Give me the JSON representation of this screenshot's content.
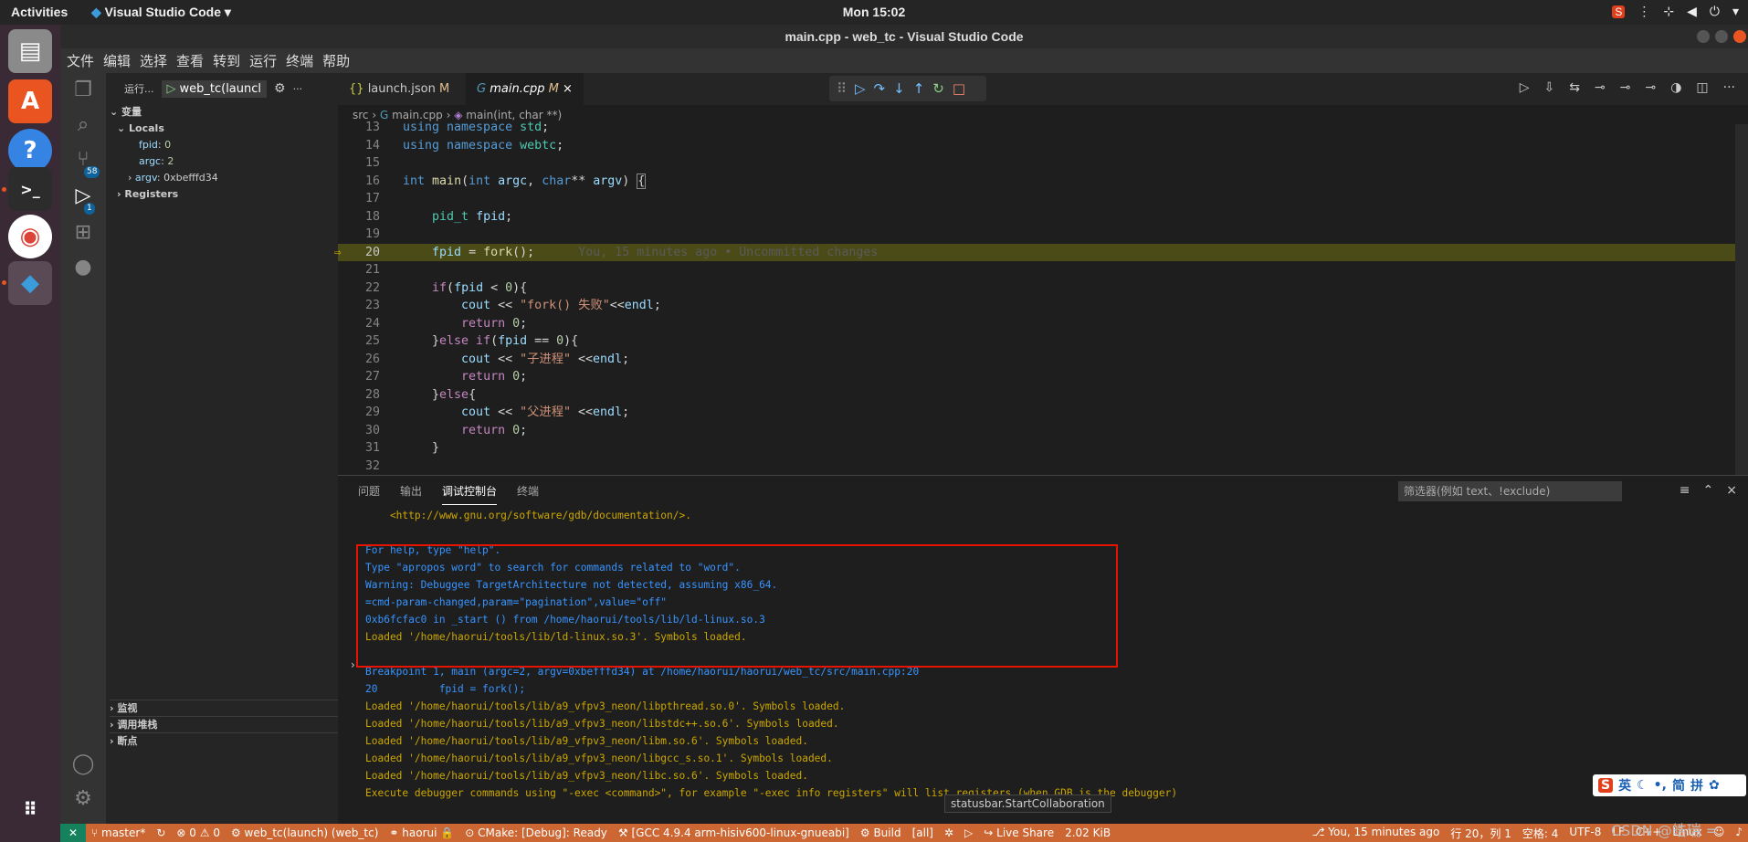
{
  "topbar": {
    "activities": "Activities",
    "app": "Visual Studio Code",
    "clock": "Mon 15:02"
  },
  "window": {
    "title": "main.cpp - web_tc - Visual Studio Code"
  },
  "menu": [
    "文件",
    "编辑",
    "选择",
    "查看",
    "转到",
    "运行",
    "终端",
    "帮助"
  ],
  "activity": {
    "scm_badge": "58",
    "debug_badge": "1"
  },
  "sidebar": {
    "run_label": "运行...",
    "config": "web_tc(launcl",
    "variables": "变量",
    "locals": "Locals",
    "vars": [
      {
        "name": "fpid",
        "value": "0"
      },
      {
        "name": "argc",
        "value": "2"
      },
      {
        "name": "argv",
        "value": "0xbefffd34"
      }
    ],
    "registers": "Registers",
    "watch": "监视",
    "callstack": "调用堆栈",
    "breakpoints": "断点"
  },
  "tabs": [
    {
      "label": "launch.json",
      "mod": "M"
    },
    {
      "label": "main.cpp",
      "mod": "M"
    }
  ],
  "breadcrumb": {
    "a": "src",
    "b": "main.cpp",
    "c": "main(int, char **)"
  },
  "code": [
    {
      "n": "13",
      "h": "<span class='kw'>using namespace</span> <span class='ty'>std</span>;"
    },
    {
      "n": "14",
      "h": "<span class='kw'>using namespace</span> <span class='ty'>webtc</span>;"
    },
    {
      "n": "15",
      "h": ""
    },
    {
      "n": "16",
      "h": "<span class='kw'>int</span> <span class='fn'>main</span>(<span class='kw'>int</span> <span class='vr'>argc</span>, <span class='kw'>char</span>** <span class='vr'>argv</span>) <span style='border:1px solid #888'>{</span>"
    },
    {
      "n": "17",
      "h": ""
    },
    {
      "n": "18",
      "h": "    <span class='ty'>pid_t</span> <span class='vr'>fpid</span>;"
    },
    {
      "n": "19",
      "h": ""
    },
    {
      "n": "20",
      "h": "    <span class='vr'>fpid</span> = <span class='fn'>fork</span>();      <span class='cm'>You, 15 minutes ago • Uncommitted changes</span>",
      "hl": true
    },
    {
      "n": "21",
      "h": ""
    },
    {
      "n": "22",
      "h": "    <span class='kc'>if</span>(<span class='vr'>fpid</span> &lt; <span class='nu'>0</span>){"
    },
    {
      "n": "23",
      "h": "        <span class='vr'>cout</span> &lt;&lt; <span class='st'>\"fork() 失败\"</span>&lt;&lt;<span class='vr'>endl</span>;"
    },
    {
      "n": "24",
      "h": "        <span class='kc'>return</span> <span class='nu'>0</span>;"
    },
    {
      "n": "25",
      "h": "    }<span class='kc'>else if</span>(<span class='vr'>fpid</span> == <span class='nu'>0</span>){"
    },
    {
      "n": "26",
      "h": "        <span class='vr'>cout</span> &lt;&lt; <span class='st'>\"子进程\"</span> &lt;&lt;<span class='vr'>endl</span>;"
    },
    {
      "n": "27",
      "h": "        <span class='kc'>return</span> <span class='nu'>0</span>;"
    },
    {
      "n": "28",
      "h": "    }<span class='kc'>else</span>{"
    },
    {
      "n": "29",
      "h": "        <span class='vr'>cout</span> &lt;&lt; <span class='st'>\"父进程\"</span> &lt;&lt;<span class='vr'>endl</span>;"
    },
    {
      "n": "30",
      "h": "        <span class='kc'>return</span> <span class='nu'>0</span>;"
    },
    {
      "n": "31",
      "h": "    }"
    },
    {
      "n": "32",
      "h": ""
    }
  ],
  "panel": {
    "tabs": [
      "问题",
      "输出",
      "调试控制台",
      "终端"
    ],
    "filter": "筛选器(例如 text、!exclude)",
    "lines": [
      {
        "t": "    <http://www.gnu.org/software/gdb/documentation/>.",
        "c": "o-y"
      },
      {
        "t": "",
        "c": "o-y"
      },
      {
        "t": "For help, type \"help\".",
        "c": "o-b"
      },
      {
        "t": "Type \"apropos word\" to search for commands related to \"word\".",
        "c": "o-b"
      },
      {
        "t": "Warning: Debuggee TargetArchitecture not detected, assuming x86_64.",
        "c": "o-b"
      },
      {
        "t": "=cmd-param-changed,param=\"pagination\",value=\"off\"",
        "c": "o-b"
      },
      {
        "t": "0xb6fcfac0 in _start () from /home/haorui/tools/lib/ld-linux.so.3",
        "c": "o-b"
      },
      {
        "t": "Loaded '/home/haorui/tools/lib/ld-linux.so.3'. Symbols loaded.",
        "c": "o-y"
      },
      {
        "t": "",
        "c": "o-y"
      },
      {
        "t": "Breakpoint 1, main (argc=2, argv=0xbefffd34) at /home/haorui/haorui/web_tc/src/main.cpp:20",
        "c": "o-b"
      },
      {
        "t": "20          fpid = fork();",
        "c": "o-b"
      },
      {
        "t": "Loaded '/home/haorui/tools/lib/a9_vfpv3_neon/libpthread.so.0'. Symbols loaded.",
        "c": "o-y"
      },
      {
        "t": "Loaded '/home/haorui/tools/lib/a9_vfpv3_neon/libstdc++.so.6'. Symbols loaded.",
        "c": "o-y"
      },
      {
        "t": "Loaded '/home/haorui/tools/lib/a9_vfpv3_neon/libm.so.6'. Symbols loaded.",
        "c": "o-y"
      },
      {
        "t": "Loaded '/home/haorui/tools/lib/a9_vfpv3_neon/libgcc_s.so.1'. Symbols loaded.",
        "c": "o-y"
      },
      {
        "t": "Loaded '/home/haorui/tools/lib/a9_vfpv3_neon/libc.so.6'. Symbols loaded.",
        "c": "o-y"
      },
      {
        "t": "Execute debugger commands using \"-exec <command>\", for example \"-exec info registers\" will list registers (when GDB is the debugger)",
        "c": "o-y"
      }
    ]
  },
  "tooltip": "statusbar.StartCollaboration",
  "status": {
    "branch": "master*",
    "errors": "0",
    "warnings": "0",
    "launch": "web_tc(launch) (web_tc)",
    "user": "haorui",
    "cmake": "CMake: [Debug]: Ready",
    "kit": "[GCC 4.9.4 arm-hisiv600-linux-gnueabi]",
    "build": "Build",
    "all": "[all]",
    "liveshare": "Live Share",
    "size": "2.02 KiB",
    "blame": "You, 15 minutes ago",
    "pos": "行 20，列 1",
    "spaces": "空格: 4",
    "enc": "UTF-8",
    "eol": "LF",
    "lang": "C++",
    "os": "Linux"
  },
  "ime": {
    "s": "S",
    "mode": "英",
    "simp": "简",
    "pin": "拼"
  },
  "watermark": "CSDN @皓瑞 ="
}
